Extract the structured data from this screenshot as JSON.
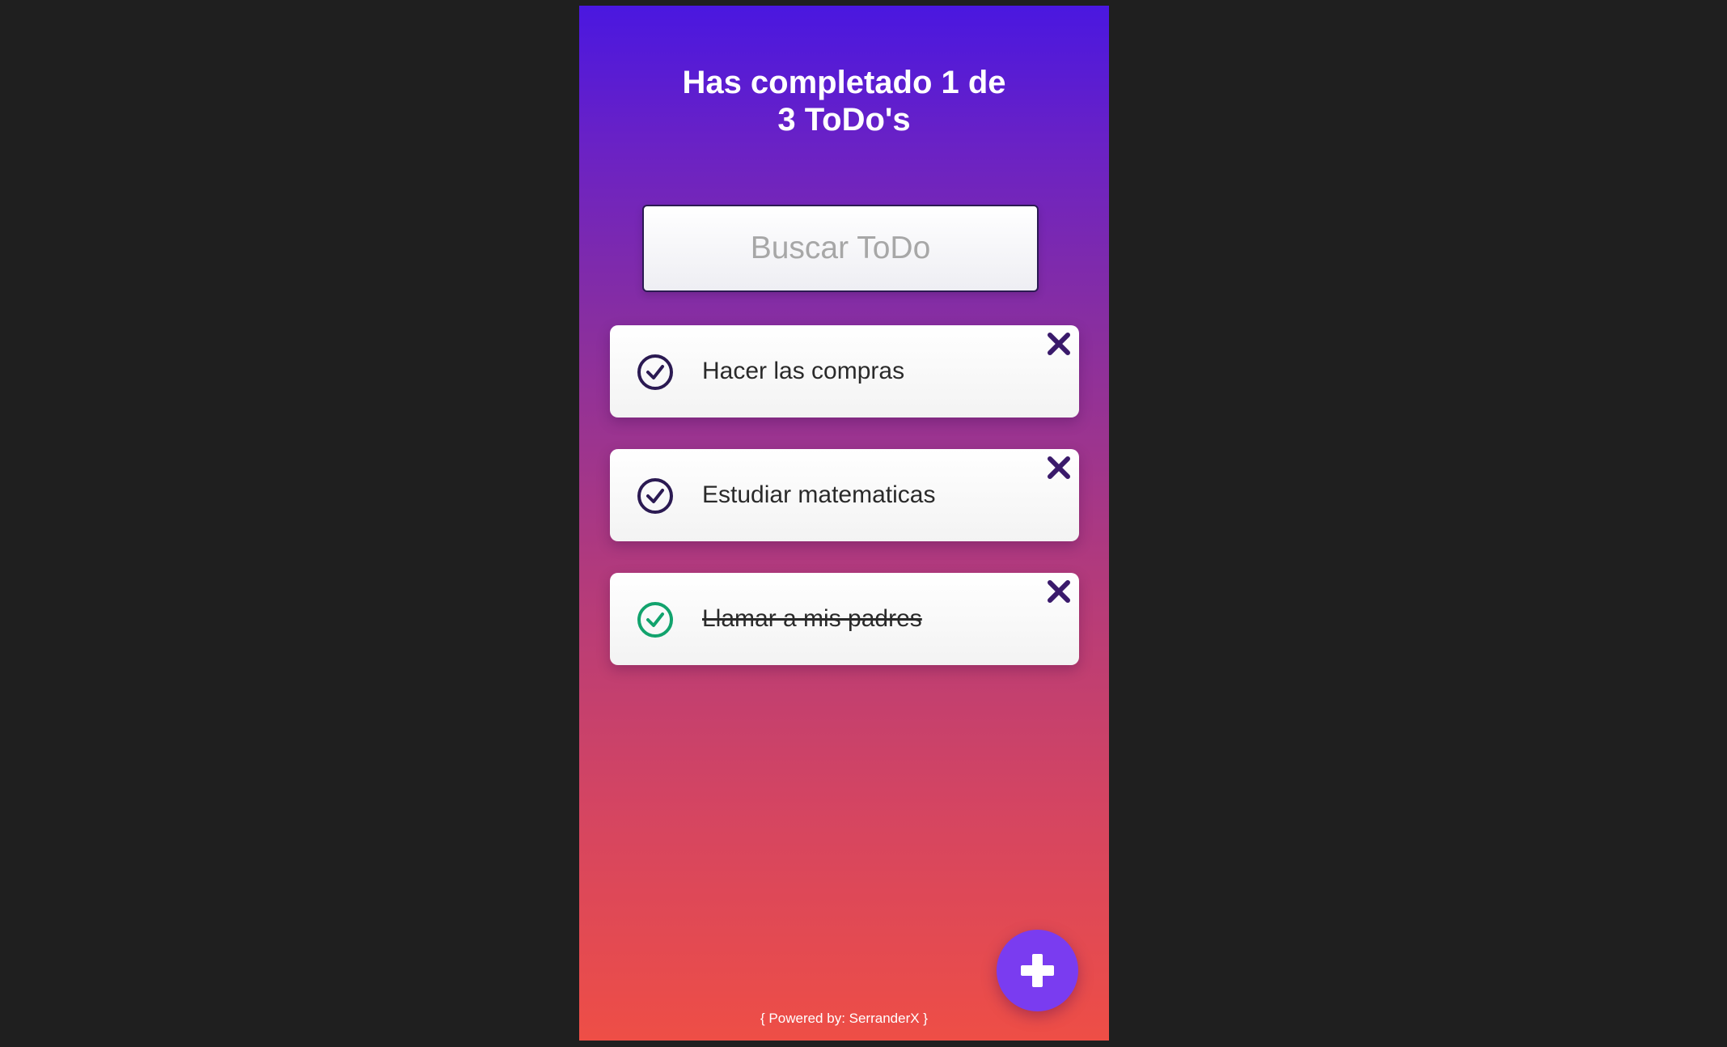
{
  "header": {
    "title_line1": "Has completado 1 de",
    "title_line2": "3 ToDo's"
  },
  "search": {
    "placeholder": "Buscar ToDo",
    "value": ""
  },
  "todos": [
    {
      "text": "Hacer las compras",
      "completed": false
    },
    {
      "text": "Estudiar matematicas",
      "completed": false
    },
    {
      "text": "Llamar a mis padres",
      "completed": true
    }
  ],
  "icons": {
    "check": "check-circle-icon",
    "delete": "close-icon",
    "add": "plus-icon"
  },
  "colors": {
    "gradient_top": "#4a17e0",
    "gradient_bottom": "#ee4e46",
    "check_pending": "#2b1a52",
    "check_done": "#12a36d",
    "delete": "#3a1a6b",
    "fab": "#7a3cf0"
  },
  "footer": {
    "text": "{ Powered by: SerranderX }"
  }
}
